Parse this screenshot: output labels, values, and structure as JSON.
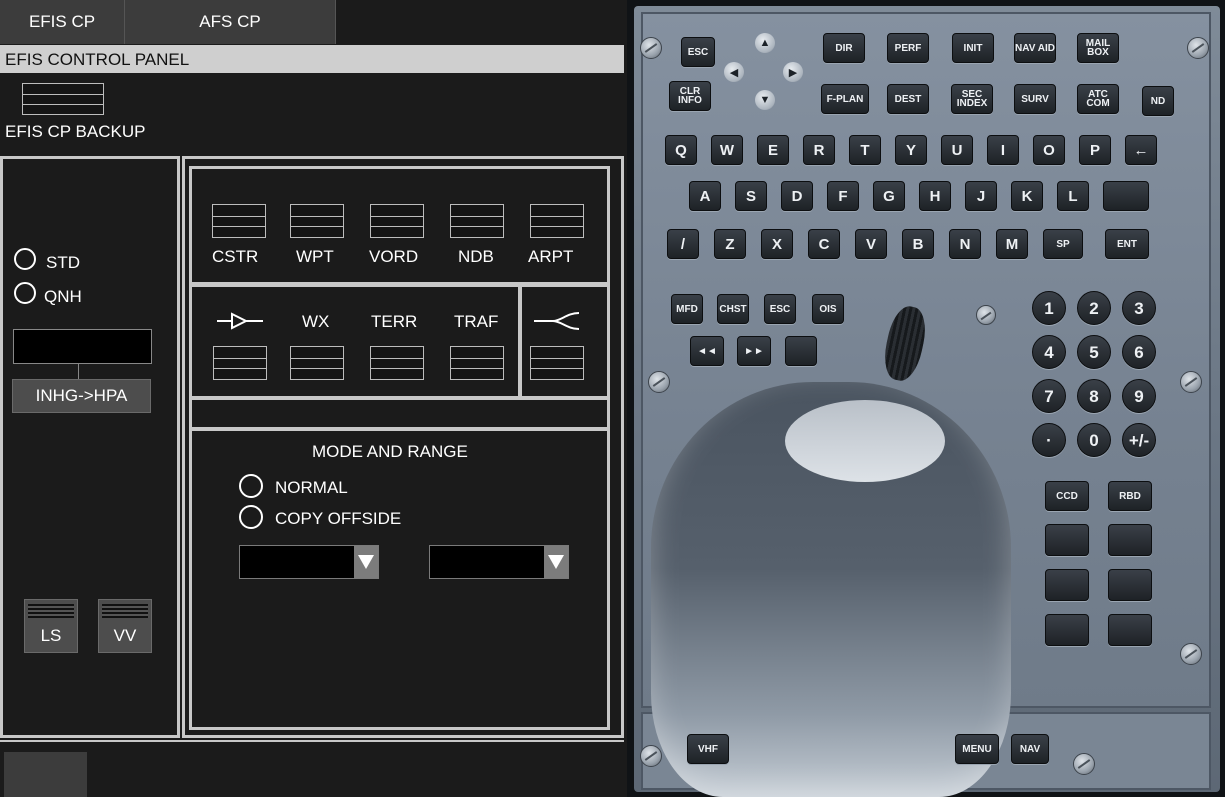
{
  "tabs": [
    {
      "label": "EFIS CP"
    },
    {
      "label": "AFS CP"
    }
  ],
  "panel": {
    "title": "EFIS CONTROL PANEL",
    "backup_label": "EFIS CP BACKUP",
    "baro": {
      "std_label": "STD",
      "qnh_label": "QNH",
      "value": "",
      "convert_button": "INHG->HPA"
    },
    "ls_label": "LS",
    "vv_label": "VV",
    "overlay_buttons": [
      {
        "label": "CSTR"
      },
      {
        "label": "WPT"
      },
      {
        "label": "VORD"
      },
      {
        "label": "NDB"
      },
      {
        "label": "ARPT"
      }
    ],
    "wx_row": [
      {
        "label": "→▷—",
        "icon": "weather-radar-symbol-icon"
      },
      {
        "label": "WX"
      },
      {
        "label": "TERR"
      },
      {
        "label": "TRAF"
      }
    ],
    "mode_range": {
      "title": "MODE AND RANGE",
      "normal_label": "NORMAL",
      "copy_label": "COPY OFFSIDE",
      "mode_value": "",
      "range_value": ""
    }
  },
  "mcdu": {
    "row1": [
      "ESC",
      "DIR",
      "PERF",
      "INIT",
      "NAV AID",
      "MAIL BOX"
    ],
    "row2": [
      "CLR INFO",
      "F-PLAN",
      "DEST",
      "SEC INDEX",
      "SURV",
      "ATC COM",
      "ND"
    ],
    "letters1": [
      "Q",
      "W",
      "E",
      "R",
      "T",
      "Y",
      "U",
      "I",
      "O",
      "P",
      "←"
    ],
    "letters2": [
      "A",
      "S",
      "D",
      "F",
      "G",
      "H",
      "J",
      "K",
      "L",
      ""
    ],
    "letters3": [
      "/",
      "Z",
      "X",
      "C",
      "V",
      "B",
      "N",
      "M",
      "SP",
      "ENT"
    ],
    "kccu1": [
      "MFD",
      "CHST",
      "ESC",
      "OIS"
    ],
    "kccu2": [
      "◄◄",
      "►►",
      ""
    ],
    "numpad": [
      "1",
      "2",
      "3",
      "4",
      "5",
      "6",
      "7",
      "8",
      "9",
      "·",
      "0",
      "+/-"
    ],
    "side": [
      "CCD",
      "RBD"
    ],
    "bottom": [
      "VHF",
      "MENU",
      "NAV"
    ],
    "colors": {
      "key": "#262b31",
      "plate": "#7c8897"
    }
  }
}
